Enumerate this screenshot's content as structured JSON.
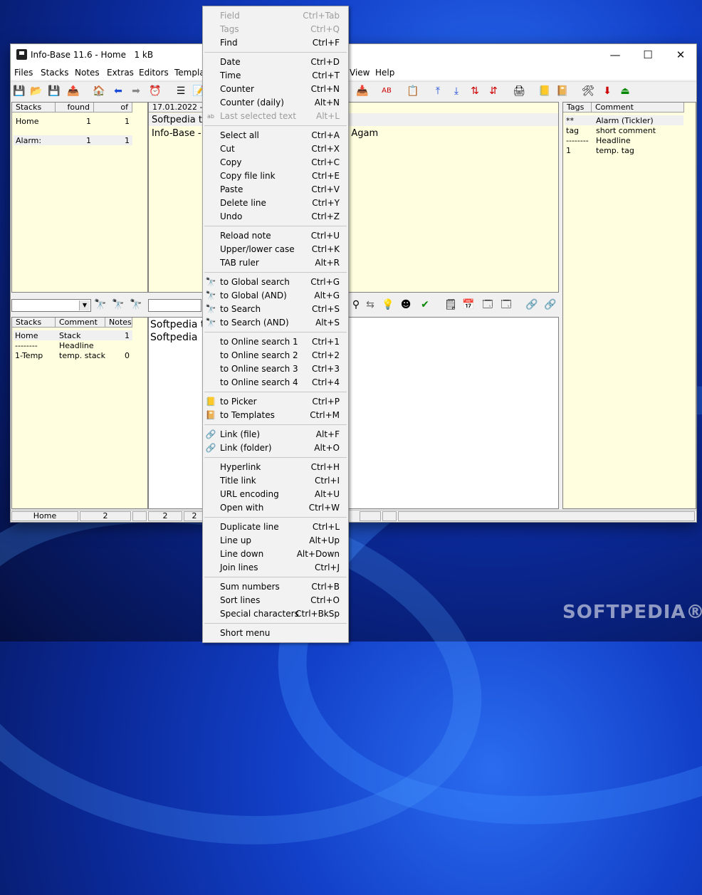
{
  "window": {
    "title": "Info-Base 11.6 - Home",
    "size": "1 kB"
  },
  "winbtns": {
    "min": "—",
    "max": "☐",
    "close": "✕"
  },
  "menubar": [
    "Files",
    "Stacks",
    "Notes",
    "Extras",
    "Editors",
    "Templat",
    "View",
    "Help"
  ],
  "stacks_table": {
    "headers": [
      "Stacks",
      "found",
      "of"
    ],
    "rows": [
      [
        "Home",
        "1",
        "1"
      ],
      [
        "Alarm:",
        "1",
        "1"
      ]
    ]
  },
  "note_header": {
    "date": "17.01.2022  -"
  },
  "note_lines": [
    "Softpedia te",
    "Info-Base - C",
    "n Agam"
  ],
  "tags_table": {
    "headers": [
      "Tags",
      "Comment"
    ],
    "rows": [
      [
        "**",
        "Alarm (Tickler)"
      ],
      [
        "tag",
        "short comment"
      ],
      [
        "--------",
        "Headline"
      ],
      [
        "1",
        "temp. tag"
      ]
    ]
  },
  "stacks2_table": {
    "headers": [
      "Stacks",
      "Comment",
      "Notes"
    ],
    "rows": [
      [
        "Home",
        "Stack",
        "1"
      ],
      [
        "--------",
        "Headline",
        ""
      ],
      [
        "1-Temp",
        "temp. stack",
        "0"
      ]
    ]
  },
  "editor_lines": [
    "Softpedia te",
    "Softpedia"
  ],
  "status": {
    "stack": "Home",
    "count": "2",
    "count2": "2",
    "count3": "2"
  },
  "context_menu": [
    {
      "label": "Field",
      "shortcut": "Ctrl+Tab",
      "disabled": true
    },
    {
      "label": "Tags",
      "shortcut": "Ctrl+Q",
      "disabled": true
    },
    {
      "label": "Find",
      "shortcut": "Ctrl+F"
    },
    {
      "label": "Date",
      "shortcut": "Ctrl+D"
    },
    {
      "label": "Time",
      "shortcut": "Ctrl+T"
    },
    {
      "label": "Counter",
      "shortcut": "Ctrl+N"
    },
    {
      "label": "Counter (daily)",
      "shortcut": "Alt+N"
    },
    {
      "label": "Last selected text",
      "shortcut": "Alt+L",
      "disabled": true
    },
    {
      "label": "Select all",
      "shortcut": "Ctrl+A"
    },
    {
      "label": "Cut",
      "shortcut": "Ctrl+X"
    },
    {
      "label": "Copy",
      "shortcut": "Ctrl+C"
    },
    {
      "label": "Copy file link",
      "shortcut": "Ctrl+E"
    },
    {
      "label": "Paste",
      "shortcut": "Ctrl+V"
    },
    {
      "label": "Delete line",
      "shortcut": "Ctrl+Y"
    },
    {
      "label": "Undo",
      "shortcut": "Ctrl+Z"
    },
    {
      "label": "Reload note",
      "shortcut": "Ctrl+U"
    },
    {
      "label": "Upper/lower case",
      "shortcut": "Ctrl+K"
    },
    {
      "label": "TAB ruler",
      "shortcut": "Alt+R"
    },
    {
      "label": "to Global search",
      "shortcut": "Ctrl+G"
    },
    {
      "label": "to Global (AND)",
      "shortcut": "Alt+G"
    },
    {
      "label": "to Search",
      "shortcut": "Ctrl+S"
    },
    {
      "label": "to Search (AND)",
      "shortcut": "Alt+S"
    },
    {
      "label": "to Online search 1",
      "shortcut": "Ctrl+1"
    },
    {
      "label": "to Online search 2",
      "shortcut": "Ctrl+2"
    },
    {
      "label": "to Online search 3",
      "shortcut": "Ctrl+3"
    },
    {
      "label": "to Online search 4",
      "shortcut": "Ctrl+4"
    },
    {
      "label": "to Picker",
      "shortcut": "Ctrl+P"
    },
    {
      "label": "to Templates",
      "shortcut": "Ctrl+M"
    },
    {
      "label": "Link (file)",
      "shortcut": "Alt+F"
    },
    {
      "label": "Link (folder)",
      "shortcut": "Alt+O"
    },
    {
      "label": "Hyperlink",
      "shortcut": "Ctrl+H"
    },
    {
      "label": "Title link",
      "shortcut": "Ctrl+I"
    },
    {
      "label": "URL encoding",
      "shortcut": "Alt+U"
    },
    {
      "label": "Open with",
      "shortcut": "Ctrl+W"
    },
    {
      "label": "Duplicate line",
      "shortcut": "Ctrl+L"
    },
    {
      "label": "Line up",
      "shortcut": "Alt+Up"
    },
    {
      "label": "Line down",
      "shortcut": "Alt+Down"
    },
    {
      "label": "Join lines",
      "shortcut": "Ctrl+J"
    },
    {
      "label": "Sum numbers",
      "shortcut": "Ctrl+B"
    },
    {
      "label": "Sort lines",
      "shortcut": "Ctrl+O"
    },
    {
      "label": "Special characters",
      "shortcut": "Ctrl+BkSp"
    },
    {
      "label": "Short menu",
      "shortcut": ""
    }
  ],
  "watermark": "SOFTPEDIA®"
}
